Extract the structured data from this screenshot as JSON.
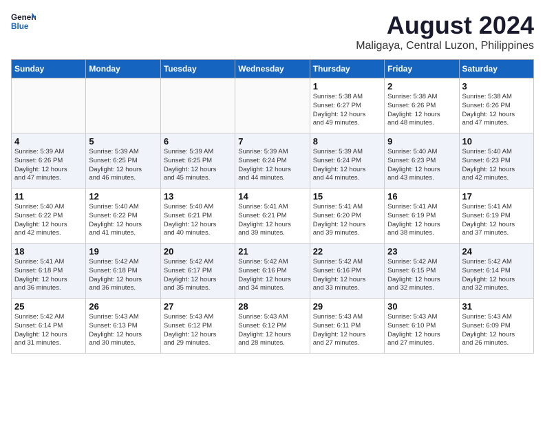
{
  "logo": {
    "line1": "General",
    "line2": "Blue"
  },
  "title": "August 2024",
  "subtitle": "Maligaya, Central Luzon, Philippines",
  "days_of_week": [
    "Sunday",
    "Monday",
    "Tuesday",
    "Wednesday",
    "Thursday",
    "Friday",
    "Saturday"
  ],
  "weeks": [
    [
      {
        "num": "",
        "info": ""
      },
      {
        "num": "",
        "info": ""
      },
      {
        "num": "",
        "info": ""
      },
      {
        "num": "",
        "info": ""
      },
      {
        "num": "1",
        "info": "Sunrise: 5:38 AM\nSunset: 6:27 PM\nDaylight: 12 hours\nand 49 minutes."
      },
      {
        "num": "2",
        "info": "Sunrise: 5:38 AM\nSunset: 6:26 PM\nDaylight: 12 hours\nand 48 minutes."
      },
      {
        "num": "3",
        "info": "Sunrise: 5:38 AM\nSunset: 6:26 PM\nDaylight: 12 hours\nand 47 minutes."
      }
    ],
    [
      {
        "num": "4",
        "info": "Sunrise: 5:39 AM\nSunset: 6:26 PM\nDaylight: 12 hours\nand 47 minutes."
      },
      {
        "num": "5",
        "info": "Sunrise: 5:39 AM\nSunset: 6:25 PM\nDaylight: 12 hours\nand 46 minutes."
      },
      {
        "num": "6",
        "info": "Sunrise: 5:39 AM\nSunset: 6:25 PM\nDaylight: 12 hours\nand 45 minutes."
      },
      {
        "num": "7",
        "info": "Sunrise: 5:39 AM\nSunset: 6:24 PM\nDaylight: 12 hours\nand 44 minutes."
      },
      {
        "num": "8",
        "info": "Sunrise: 5:39 AM\nSunset: 6:24 PM\nDaylight: 12 hours\nand 44 minutes."
      },
      {
        "num": "9",
        "info": "Sunrise: 5:40 AM\nSunset: 6:23 PM\nDaylight: 12 hours\nand 43 minutes."
      },
      {
        "num": "10",
        "info": "Sunrise: 5:40 AM\nSunset: 6:23 PM\nDaylight: 12 hours\nand 42 minutes."
      }
    ],
    [
      {
        "num": "11",
        "info": "Sunrise: 5:40 AM\nSunset: 6:22 PM\nDaylight: 12 hours\nand 42 minutes."
      },
      {
        "num": "12",
        "info": "Sunrise: 5:40 AM\nSunset: 6:22 PM\nDaylight: 12 hours\nand 41 minutes."
      },
      {
        "num": "13",
        "info": "Sunrise: 5:40 AM\nSunset: 6:21 PM\nDaylight: 12 hours\nand 40 minutes."
      },
      {
        "num": "14",
        "info": "Sunrise: 5:41 AM\nSunset: 6:21 PM\nDaylight: 12 hours\nand 39 minutes."
      },
      {
        "num": "15",
        "info": "Sunrise: 5:41 AM\nSunset: 6:20 PM\nDaylight: 12 hours\nand 39 minutes."
      },
      {
        "num": "16",
        "info": "Sunrise: 5:41 AM\nSunset: 6:19 PM\nDaylight: 12 hours\nand 38 minutes."
      },
      {
        "num": "17",
        "info": "Sunrise: 5:41 AM\nSunset: 6:19 PM\nDaylight: 12 hours\nand 37 minutes."
      }
    ],
    [
      {
        "num": "18",
        "info": "Sunrise: 5:41 AM\nSunset: 6:18 PM\nDaylight: 12 hours\nand 36 minutes."
      },
      {
        "num": "19",
        "info": "Sunrise: 5:42 AM\nSunset: 6:18 PM\nDaylight: 12 hours\nand 36 minutes."
      },
      {
        "num": "20",
        "info": "Sunrise: 5:42 AM\nSunset: 6:17 PM\nDaylight: 12 hours\nand 35 minutes."
      },
      {
        "num": "21",
        "info": "Sunrise: 5:42 AM\nSunset: 6:16 PM\nDaylight: 12 hours\nand 34 minutes."
      },
      {
        "num": "22",
        "info": "Sunrise: 5:42 AM\nSunset: 6:16 PM\nDaylight: 12 hours\nand 33 minutes."
      },
      {
        "num": "23",
        "info": "Sunrise: 5:42 AM\nSunset: 6:15 PM\nDaylight: 12 hours\nand 32 minutes."
      },
      {
        "num": "24",
        "info": "Sunrise: 5:42 AM\nSunset: 6:14 PM\nDaylight: 12 hours\nand 32 minutes."
      }
    ],
    [
      {
        "num": "25",
        "info": "Sunrise: 5:42 AM\nSunset: 6:14 PM\nDaylight: 12 hours\nand 31 minutes."
      },
      {
        "num": "26",
        "info": "Sunrise: 5:43 AM\nSunset: 6:13 PM\nDaylight: 12 hours\nand 30 minutes."
      },
      {
        "num": "27",
        "info": "Sunrise: 5:43 AM\nSunset: 6:12 PM\nDaylight: 12 hours\nand 29 minutes."
      },
      {
        "num": "28",
        "info": "Sunrise: 5:43 AM\nSunset: 6:12 PM\nDaylight: 12 hours\nand 28 minutes."
      },
      {
        "num": "29",
        "info": "Sunrise: 5:43 AM\nSunset: 6:11 PM\nDaylight: 12 hours\nand 27 minutes."
      },
      {
        "num": "30",
        "info": "Sunrise: 5:43 AM\nSunset: 6:10 PM\nDaylight: 12 hours\nand 27 minutes."
      },
      {
        "num": "31",
        "info": "Sunrise: 5:43 AM\nSunset: 6:09 PM\nDaylight: 12 hours\nand 26 minutes."
      }
    ]
  ]
}
